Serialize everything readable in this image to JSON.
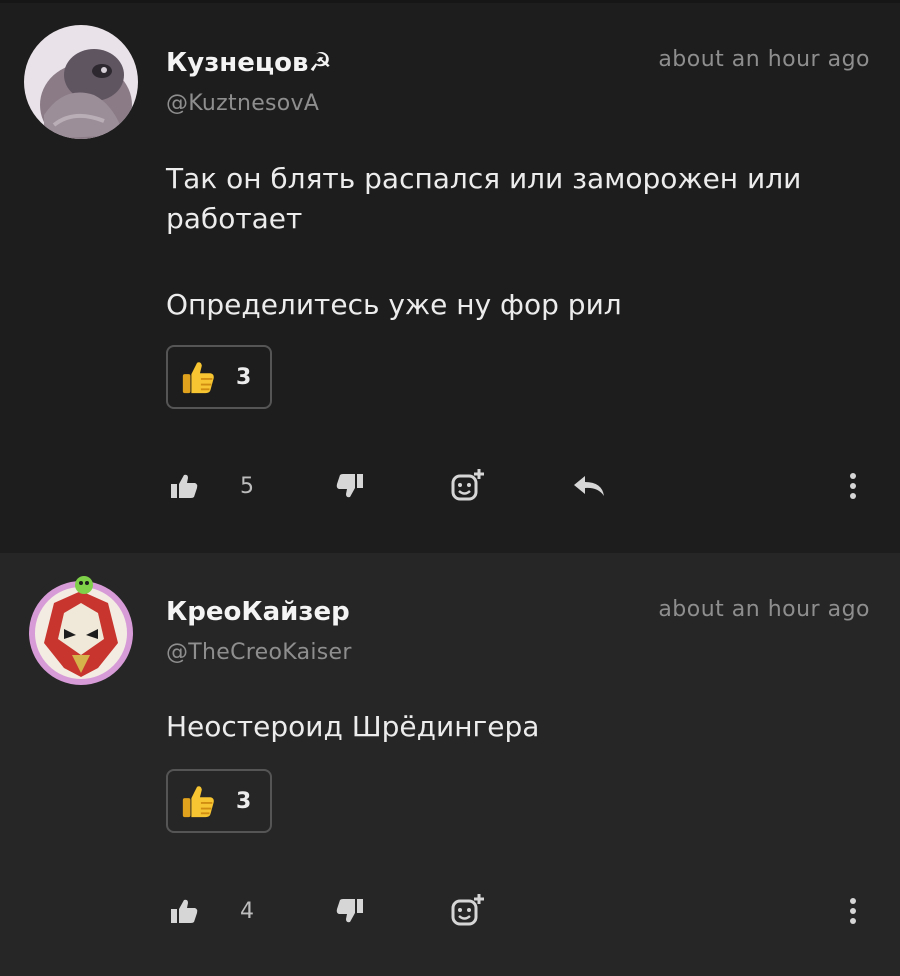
{
  "comments": [
    {
      "author": "Кузнецов☭",
      "handle": "@KuztnesovA",
      "time": "about an hour ago",
      "paragraphs": [
        "Так он блять распался или заморожен или работает",
        "Определитесь уже ну фор рил"
      ],
      "reaction": {
        "emoji": "thumbs-up",
        "count": "3"
      },
      "likes": "5"
    },
    {
      "author": "КреоКайзер",
      "handle": "@TheCreoKaiser",
      "time": "about an hour ago",
      "paragraphs": [
        "Неостероид Шрёдингера"
      ],
      "reaction": {
        "emoji": "thumbs-up",
        "count": "3"
      },
      "likes": "4"
    }
  ],
  "colors": {
    "background": "#1d1d1d",
    "background_alt": "#262626",
    "muted_text": "#8e8e8e",
    "text": "#ececec",
    "reaction_emoji": "#f7c531"
  }
}
